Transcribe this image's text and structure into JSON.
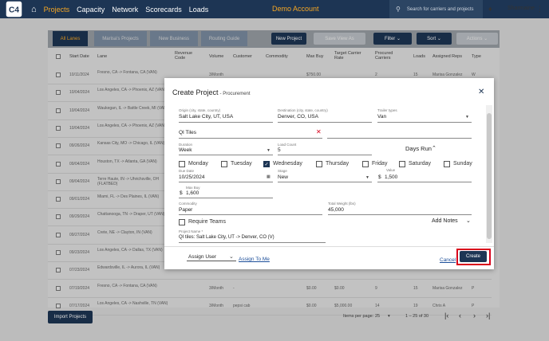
{
  "nav": {
    "logo": "C4",
    "links": [
      "Projects",
      "Capacity",
      "Network",
      "Scorecards",
      "Loads"
    ],
    "demo": "Demo Account",
    "search_placeholder": "Search for carriers and projects",
    "user": "Sharmaine"
  },
  "toolbar": {
    "tabs": [
      "All Lanes",
      "Marisa's Projects",
      "New Business",
      "Routing Guide"
    ],
    "new_project": "New Project",
    "save_view": "Save View As",
    "filter": "Filter",
    "sort": "Sort",
    "actions": "Actions"
  },
  "table": {
    "headers": [
      "Start Date",
      "Lane",
      "Revenue Code",
      "Volume",
      "Customer",
      "Commodity",
      "Max Buy",
      "Target Carrier Rate",
      "Procured Carriers",
      "Loads",
      "Assigned Reps",
      "Type"
    ],
    "rows": [
      {
        "date": "10/11/2024",
        "lane": "Fresno, CA -> Fontana, CA (VAN)",
        "volume": "3/Month",
        "customer": "",
        "commodity": "",
        "maxbuy": "$750.00",
        "target": "",
        "procured": "2",
        "loads": "15",
        "rep": "Marisa Gonzalez",
        "type": "W"
      },
      {
        "date": "10/04/2024",
        "lane": "Los Angeles, CA -> Phoenix, AZ (VAN)",
        "volume": "",
        "customer": "",
        "commodity": "",
        "maxbuy": "",
        "target": "",
        "procured": "",
        "loads": "",
        "rep": "",
        "type": ""
      },
      {
        "date": "10/04/2024",
        "lane": "Waukegan, IL -> Battle Creek, MI (VAN)",
        "volume": "",
        "customer": "",
        "commodity": "",
        "maxbuy": "",
        "target": "",
        "procured": "",
        "loads": "",
        "rep": "",
        "type": ""
      },
      {
        "date": "10/04/2024",
        "lane": "Los Angeles, CA -> Phoenix, AZ (VAN)",
        "volume": "",
        "customer": "",
        "commodity": "",
        "maxbuy": "",
        "target": "",
        "procured": "",
        "loads": "",
        "rep": "",
        "type": ""
      },
      {
        "date": "09/26/2024",
        "lane": "Kansas City, MO -> Chicago, IL (VAN)",
        "volume": "",
        "customer": "",
        "commodity": "",
        "maxbuy": "",
        "target": "",
        "procured": "",
        "loads": "",
        "rep": "",
        "type": ""
      },
      {
        "date": "09/04/2024",
        "lane": "Houston, TX -> Atlanta, GA (VAN)",
        "volume": "",
        "customer": "",
        "commodity": "",
        "maxbuy": "",
        "target": "",
        "procured": "",
        "loads": "",
        "rep": "",
        "type": ""
      },
      {
        "date": "09/04/2024",
        "lane": "Terre Haute, IN -> Uhrichsville, OH (FLATBED)",
        "volume": "",
        "customer": "",
        "commodity": "",
        "maxbuy": "",
        "target": "",
        "procured": "",
        "loads": "",
        "rep": "",
        "type": ""
      },
      {
        "date": "09/01/2024",
        "lane": "Miami, FL -> Des Plaines, IL (VAN)",
        "volume": "",
        "customer": "",
        "commodity": "",
        "maxbuy": "",
        "target": "",
        "procured": "",
        "loads": "",
        "rep": "",
        "type": ""
      },
      {
        "date": "09/29/2024",
        "lane": "Chattanooga, TN -> Draper, UT (VAN)",
        "volume": "",
        "customer": "",
        "commodity": "",
        "maxbuy": "",
        "target": "",
        "procured": "",
        "loads": "",
        "rep": "",
        "type": ""
      },
      {
        "date": "09/27/2024",
        "lane": "Crete, NE -> Clayton, IN (VAN)",
        "volume": "",
        "customer": "",
        "commodity": "",
        "maxbuy": "",
        "target": "",
        "procured": "",
        "loads": "",
        "rep": "",
        "type": ""
      },
      {
        "date": "09/23/2024",
        "lane": "Los Angeles, CA -> Dallas, TX (VAN)",
        "volume": "",
        "customer": "",
        "commodity": "",
        "maxbuy": "",
        "target": "",
        "procured": "",
        "loads": "",
        "rep": "",
        "type": ""
      },
      {
        "date": "07/23/2024",
        "lane": "Edwardsville, IL -> Aurora, IL (VAN)",
        "volume": "",
        "customer": "",
        "commodity": "",
        "maxbuy": "",
        "target": "",
        "procured": "",
        "loads": "",
        "rep": "",
        "type": ""
      },
      {
        "date": "07/19/2024",
        "lane": "Fresno, CA -> Fontana, CA (VAN)",
        "volume": "3/Month",
        "customer": "-",
        "commodity": "",
        "maxbuy": "$0.00",
        "target": "$0.00",
        "procured": "9",
        "loads": "15",
        "rep": "Marisa Gonzalez",
        "type": "P"
      },
      {
        "date": "07/17/2024",
        "lane": "Los Angeles, CA -> Nashville, TN (VAN)",
        "volume": "3/Month",
        "customer": "pepsi cab",
        "commodity": "",
        "maxbuy": "$0.00",
        "target": "$5,000.00",
        "procured": "14",
        "loads": "19",
        "rep": "Chris A",
        "type": "P"
      }
    ]
  },
  "footer": {
    "import": "Import Projects",
    "items_label": "Items per page:",
    "items_value": "25",
    "range": "1 – 25 of 30"
  },
  "modal": {
    "title": "Create Project",
    "subtitle": "- Procurement",
    "origin_label": "Origin (city, state, country)",
    "origin": "Salt Lake City, UT, USA",
    "destination_label": "Destination (city, state, country)",
    "destination": "Denver, CO, USA",
    "trailer_label": "Trailer types",
    "trailer": "Van",
    "customer": "QI Tiles",
    "duration_label": "Duration",
    "duration": "Week",
    "loadcount_label": "Load Count",
    "loadcount": "5",
    "days_run": "Days Run",
    "days": [
      {
        "name": "Monday",
        "checked": false
      },
      {
        "name": "Tuesday",
        "checked": false
      },
      {
        "name": "Wednesday",
        "checked": true
      },
      {
        "name": "Thursday",
        "checked": false
      },
      {
        "name": "Friday",
        "checked": false
      },
      {
        "name": "Saturday",
        "checked": false
      },
      {
        "name": "Sunday",
        "checked": false
      }
    ],
    "duedate_label": "Due Date",
    "duedate": "10/25/2024",
    "stage_label": "Stage",
    "stage": "New",
    "value_label": "Value",
    "value": "1,500",
    "maxbuy_label": "Max Buy",
    "maxbuy": "1,600",
    "currency": "$",
    "commodity_label": "Commodity",
    "commodity": "Paper",
    "weight_label": "Total Weight (lbs)",
    "weight": "45,000",
    "require_teams": "Require Teams",
    "add_notes": "Add Notes",
    "projname_label": "Project Name *",
    "projname": "QI tiles: Salt Lake City, UT -> Denver, CO (V)",
    "assign_user": "Assign User",
    "assign_me": "Assign To Me",
    "cancel": "Cancel",
    "create": "Create"
  },
  "colors": {
    "navy": "#1d3554",
    "orange": "#f5a623",
    "highlight": "#d9001b"
  }
}
